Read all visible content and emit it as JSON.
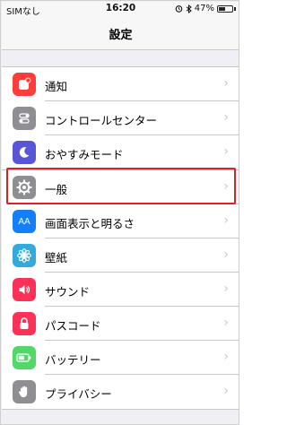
{
  "status_bar": {
    "carrier": "SIMなし",
    "time": "16:20",
    "battery_percent": "47%",
    "battery_level": 0.47
  },
  "nav": {
    "title": "設定"
  },
  "groups": [
    {
      "rows": [
        {
          "label": "通知",
          "icon": "notification-icon",
          "color": "#fc3d39"
        },
        {
          "label": "コントロールセンター",
          "icon": "control-center-icon",
          "color": "#8e8e93"
        },
        {
          "label": "おやすみモード",
          "icon": "moon-icon",
          "color": "#5856d6"
        }
      ]
    },
    {
      "rows": [
        {
          "label": "一般",
          "icon": "gear-icon",
          "color": "#8e8e93"
        },
        {
          "label": "画面表示と明るさ",
          "icon": "display-brightness-icon",
          "color": "#147efb"
        },
        {
          "label": "壁紙",
          "icon": "wallpaper-icon",
          "color": "#34aadc"
        },
        {
          "label": "サウンド",
          "icon": "speaker-icon",
          "color": "#fc3158"
        },
        {
          "label": "パスコード",
          "icon": "lock-icon",
          "color": "#fc3158"
        },
        {
          "label": "バッテリー",
          "icon": "battery-icon",
          "color": "#53d769"
        },
        {
          "label": "プライバシー",
          "icon": "hand-icon",
          "color": "#8e8e93"
        }
      ]
    }
  ],
  "icon_glyphs": {
    "display_aa": "AA"
  },
  "highlight_color": "#e02020"
}
